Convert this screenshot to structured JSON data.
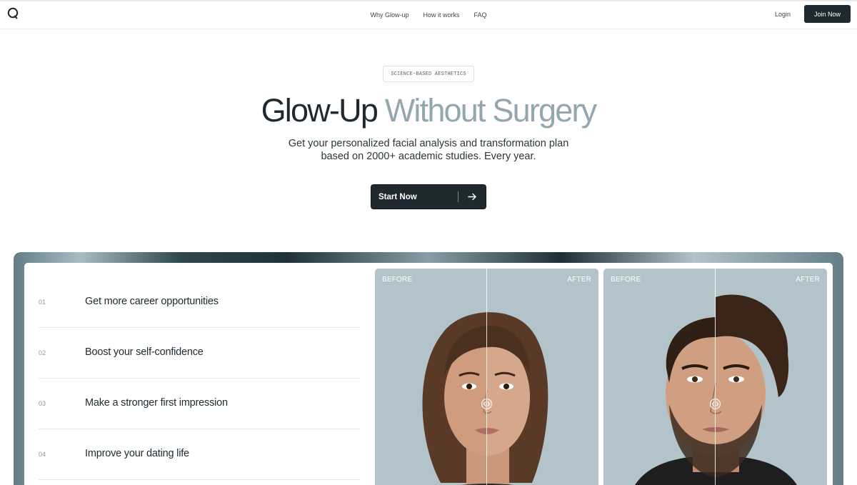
{
  "nav": {
    "links": [
      "Why Glow-up",
      "How it works",
      "FAQ"
    ],
    "login_label": "Login",
    "join_label": "Join Now"
  },
  "hero": {
    "badge": "SCIENCE-BASED AESTHETICS",
    "headline_dark": "Glow-Up",
    "headline_light": "Without Surgery",
    "subhead_line1": "Get your personalized facial analysis and transformation plan",
    "subhead_line2": "based on 2000+ academic studies. Every year.",
    "cta_label": "Start Now",
    "cta_icon": "arrow-right-icon"
  },
  "benefits": [
    {
      "num": "01",
      "text": "Get more career opportunities"
    },
    {
      "num": "02",
      "text": "Boost your self-confidence"
    },
    {
      "num": "03",
      "text": "Make a stronger first impression"
    },
    {
      "num": "04",
      "text": "Improve your dating life"
    }
  ],
  "comparisons": [
    {
      "before_label": "BEFORE",
      "after_label": "AFTER",
      "subject": "woman-portrait"
    },
    {
      "before_label": "BEFORE",
      "after_label": "AFTER",
      "subject": "man-portrait"
    }
  ],
  "colors": {
    "primary": "#1f2a30",
    "accent_text": "#93a7b0",
    "card_bg": "#b2c3c9"
  }
}
